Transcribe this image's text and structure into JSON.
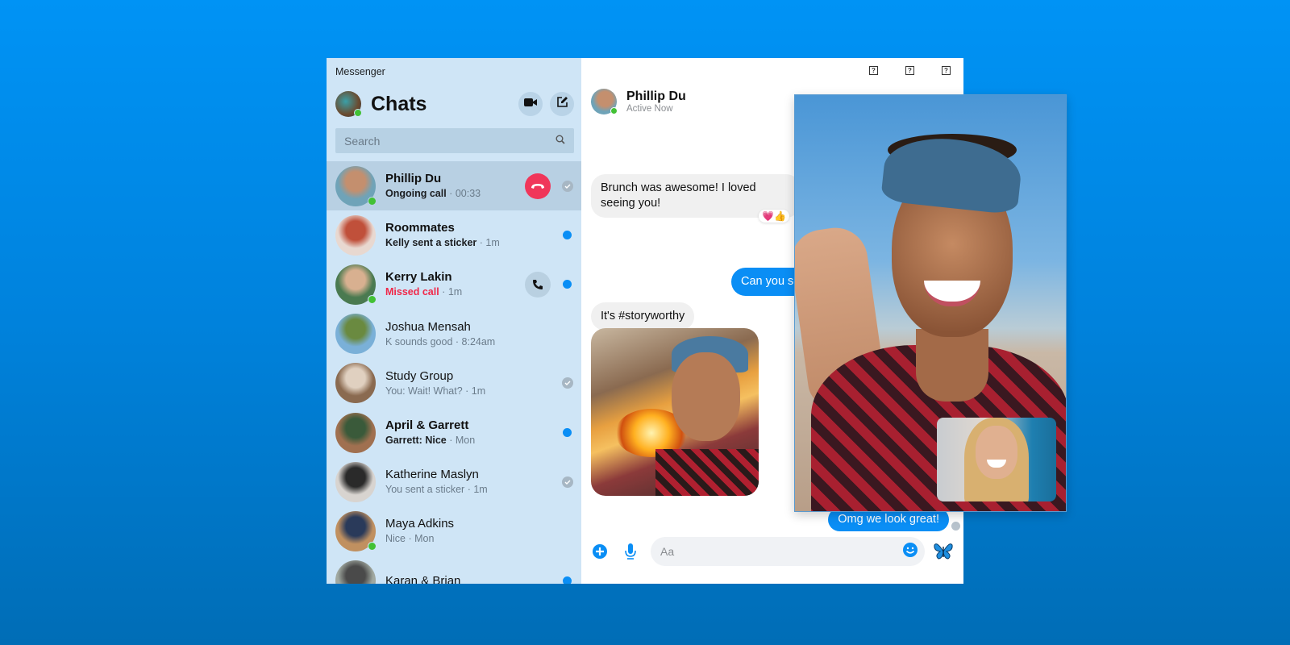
{
  "app": {
    "title": "Messenger"
  },
  "sidebar": {
    "title": "Chats",
    "video_call_icon": "video-camera-icon",
    "compose_icon": "compose-icon",
    "search": {
      "placeholder": "Search",
      "value": ""
    },
    "conversations": [
      {
        "name": "Phillip Du",
        "preview": "Ongoing call",
        "time": "00:33",
        "bold": true,
        "online": true,
        "active": true,
        "action": "hangup",
        "status": "read",
        "avatar_colors": [
          "#6fa3b8",
          "#c48f6e"
        ]
      },
      {
        "name": "Roommates",
        "preview": "Kelly sent a sticker",
        "time": "1m",
        "bold": true,
        "online": false,
        "active": false,
        "action": null,
        "status": "unread",
        "avatar_colors": [
          "#e8d8d0",
          "#c0503a"
        ]
      },
      {
        "name": "Kerry Lakin",
        "preview": "Missed call",
        "time": "1m",
        "bold": true,
        "missed": true,
        "online": true,
        "active": false,
        "action": "call",
        "status": "unread",
        "avatar_colors": [
          "#4a7a50",
          "#d8b090"
        ]
      },
      {
        "name": "Joshua Mensah",
        "preview": "K sounds good",
        "time": "8:24am",
        "bold": false,
        "online": false,
        "active": false,
        "action": null,
        "status": null,
        "avatar_colors": [
          "#7ab0d8",
          "#6a8a40"
        ]
      },
      {
        "name": "Study Group",
        "preview": "You: Wait! What?",
        "time": "1m",
        "bold": false,
        "online": false,
        "active": false,
        "action": null,
        "status": "read",
        "avatar_colors": [
          "#8a6a50",
          "#e0d0c0"
        ]
      },
      {
        "name": "April & Garrett",
        "preview": "Garrett: Nice",
        "time": "Mon",
        "bold": true,
        "online": false,
        "active": false,
        "action": null,
        "status": "unread",
        "avatar_colors": [
          "#a07050",
          "#3a5a3a"
        ]
      },
      {
        "name": "Katherine Maslyn",
        "preview": "You sent a sticker",
        "time": "1m",
        "bold": false,
        "online": false,
        "active": false,
        "action": null,
        "status": "read",
        "avatar_colors": [
          "#d8d4d0",
          "#2a2a2a"
        ]
      },
      {
        "name": "Maya Adkins",
        "preview": "Nice",
        "time": "Mon",
        "bold": false,
        "online": true,
        "active": false,
        "action": null,
        "status": null,
        "avatar_colors": [
          "#c09060",
          "#2a3a5a"
        ]
      },
      {
        "name": "Karan & Brian",
        "preview": "",
        "time": "",
        "bold": false,
        "online": false,
        "active": false,
        "action": null,
        "status": "unread",
        "avatar_colors": [
          "#a0a8a0",
          "#4a4a4a"
        ]
      }
    ]
  },
  "chat": {
    "contact_name": "Phillip Du",
    "contact_status": "Active Now",
    "window_controls": [
      "?",
      "?",
      "?"
    ],
    "messages": [
      {
        "direction": "in",
        "text": "Brunch was awesome! I loved seeing you!",
        "reactions": "💗👍"
      },
      {
        "direction": "out",
        "text": "Can you send the pic?"
      },
      {
        "direction": "in",
        "text": "It's #storyworthy"
      },
      {
        "direction": "in",
        "type": "photo",
        "alt": "Campfire selfie photo"
      },
      {
        "direction": "out",
        "text": "Omg we look great!"
      }
    ],
    "composer": {
      "placeholder": "Aa",
      "value": "",
      "add_icon": "plus-circle-icon",
      "mic_icon": "microphone-icon",
      "emoji_icon": "smiley-icon",
      "quick_reaction_icon": "butterfly-icon"
    }
  },
  "video_call": {
    "remote": "Phillip Du",
    "self_view": true
  },
  "colors": {
    "accent": "#0a8ef5",
    "online": "#42c135",
    "hangup": "#f0365a",
    "missed": "#f02849",
    "sidebar_bg": "#cfe5f6"
  }
}
